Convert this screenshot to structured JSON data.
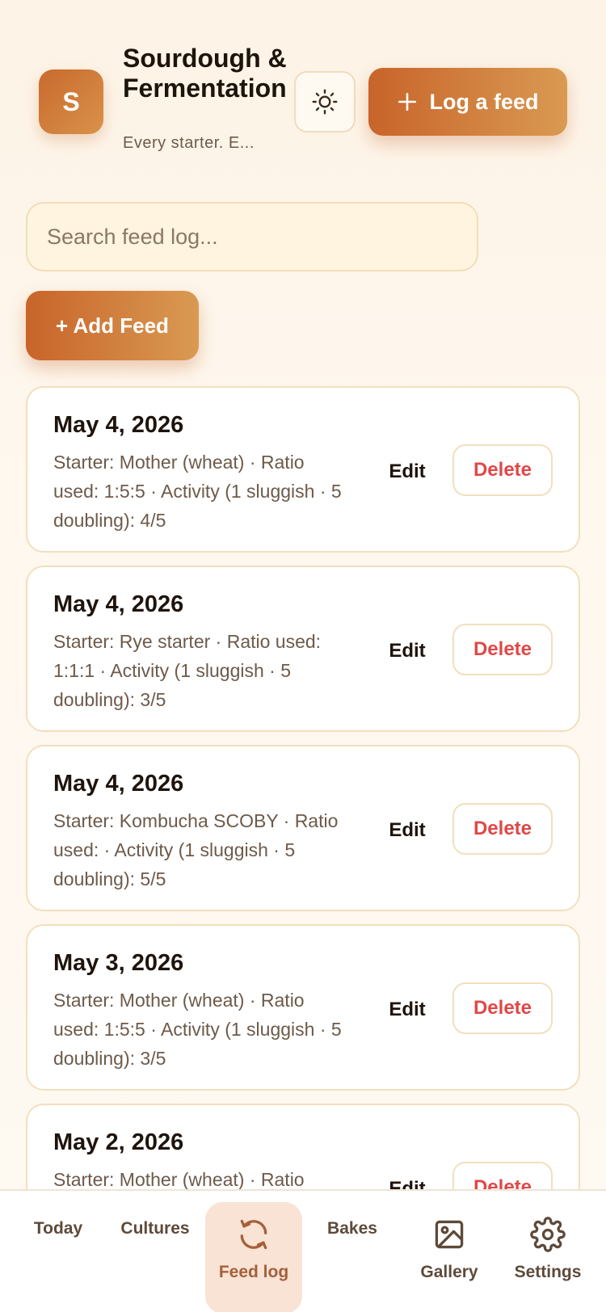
{
  "header": {
    "logo_letter": "S",
    "title": "Sourdough & Fermentation",
    "subtitle": "Every starter. E...",
    "log_button_label": "Log a feed"
  },
  "search": {
    "placeholder": "Search feed log..."
  },
  "add_button_label": "+ Add Feed",
  "feeds": [
    {
      "date": "May 4, 2026",
      "detail": "Starter: Mother (wheat) · Ratio used: 1:5:5 · Activity (1 sluggish · 5 doubling): 4/5",
      "edit_label": "Edit",
      "delete_label": "Delete"
    },
    {
      "date": "May 4, 2026",
      "detail": "Starter: Rye starter · Ratio used: 1:1:1 · Activity (1 sluggish · 5 doubling): 3/5",
      "edit_label": "Edit",
      "delete_label": "Delete"
    },
    {
      "date": "May 4, 2026",
      "detail": "Starter: Kombucha SCOBY · Ratio used: · Activity (1 sluggish · 5 doubling): 5/5",
      "edit_label": "Edit",
      "delete_label": "Delete"
    },
    {
      "date": "May 3, 2026",
      "detail": "Starter: Mother (wheat) · Ratio used: 1:5:5 · Activity (1 sluggish · 5 doubling): 3/5",
      "edit_label": "Edit",
      "delete_label": "Delete"
    },
    {
      "date": "May 2, 2026",
      "detail": "Starter: Mother (wheat) · Ratio",
      "edit_label": "Edit",
      "delete_label": "Delete"
    }
  ],
  "nav": {
    "items": [
      {
        "label": "Today",
        "icon": "none"
      },
      {
        "label": "Cultures",
        "icon": "none"
      },
      {
        "label": "Feed log",
        "icon": "refresh-icon",
        "active": true
      },
      {
        "label": "Bakes",
        "icon": "none"
      },
      {
        "label": "Gallery",
        "icon": "image-icon"
      },
      {
        "label": "Settings",
        "icon": "gear-icon"
      }
    ]
  },
  "colors": {
    "accent": "#c8642a",
    "accent_light": "#d99a52",
    "danger": "#e04848",
    "background": "#fdf3e6"
  }
}
